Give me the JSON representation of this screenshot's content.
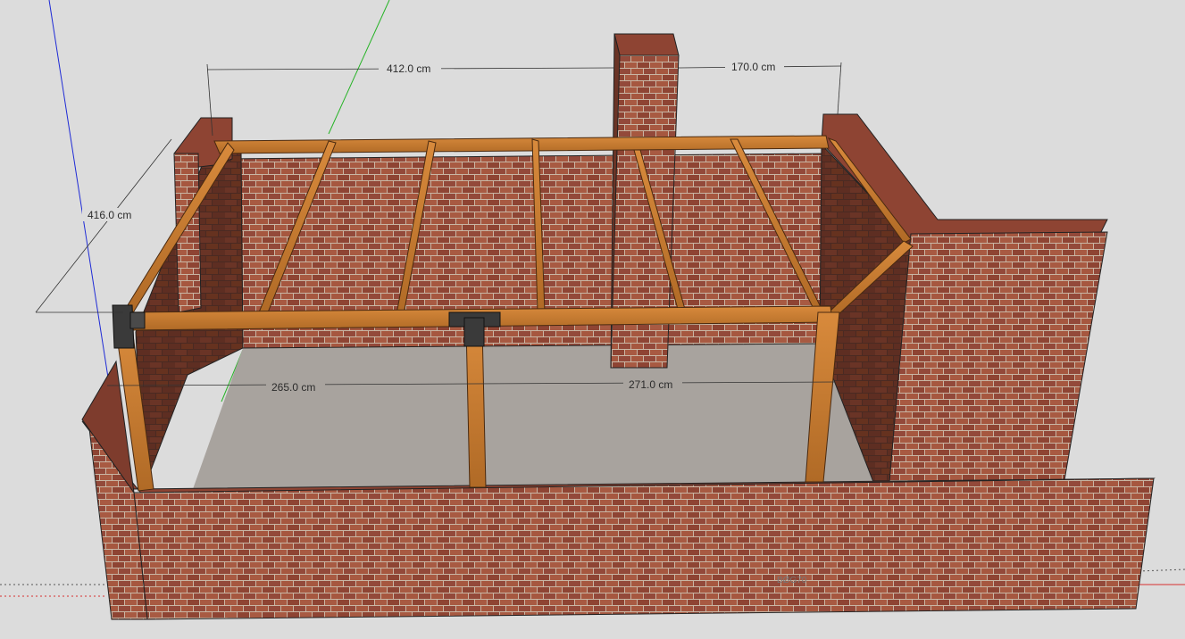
{
  "app": {
    "view": "3D model viewport"
  },
  "dimensions": {
    "top_left_width": "412.0 cm",
    "top_right_width": "170.0 cm",
    "side_depth": "416.0 cm",
    "front_left_span": "265.0 cm",
    "front_right_span": "271.0 cm"
  },
  "scene_labels": {
    "front_wall_faint_label": "BØG70"
  },
  "colors": {
    "background": "#dcdcdc",
    "brick": "#9b4e3a",
    "brick_dark": "#6a3426",
    "mortar": "#c9b6a4",
    "timber": "#c4782f",
    "timber_dark": "#8a4e1c",
    "steel_bracket": "#3a3a3a",
    "floor": "#a8a39e",
    "axis_blue": "#1f2bd6",
    "axis_green": "#25b325",
    "axis_red": "#d63030"
  }
}
